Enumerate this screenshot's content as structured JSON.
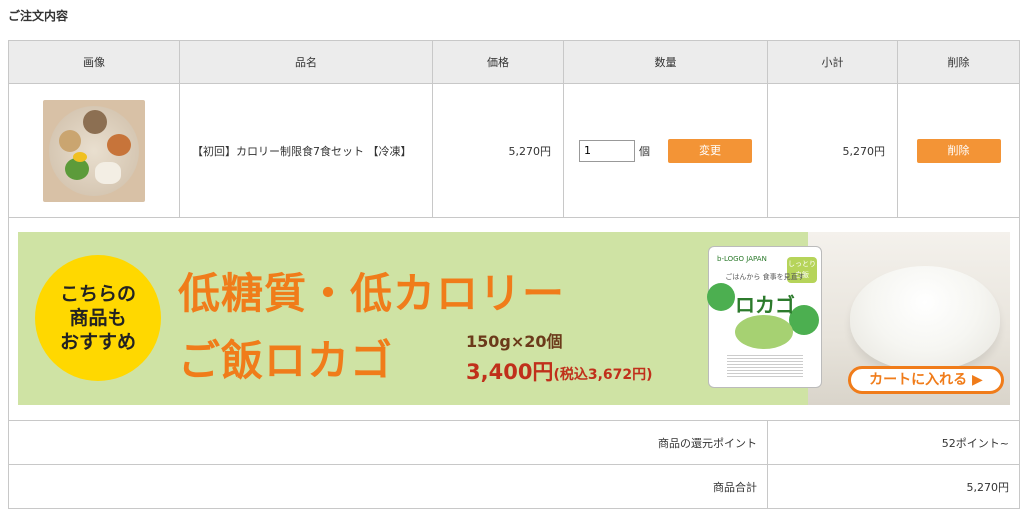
{
  "section_title": "ご注文内容",
  "headers": {
    "image": "画像",
    "name": "品名",
    "price": "価格",
    "quantity": "数量",
    "subtotal": "小計",
    "delete": "削除"
  },
  "item": {
    "name": "【初回】カロリー制限食7食セット 【冷凍】",
    "price": "5,270円",
    "quantity": "1",
    "unit": "個",
    "change_label": "変更",
    "subtotal": "5,270円",
    "delete_label": "削除"
  },
  "banner": {
    "badge_lines": [
      "こちらの",
      "商品も",
      "おすすめ"
    ],
    "headline_1": "低糖質・低カロリー",
    "headline_2": "ご飯ロカゴ",
    "qty_text": "150g×20個",
    "price_text": "3,400円",
    "tax_text": "(税込3,672円)",
    "cart_button": "カートに入れる ▶",
    "pack": {
      "brand": "b-LOGO JAPAN",
      "tagline": "ごはんから 食事を見直す",
      "name": "ロカゴ",
      "tag": "しっとり 白飯"
    }
  },
  "summary": {
    "points_label": "商品の還元ポイント",
    "points_value": "52ポイント~",
    "total_label": "商品合計",
    "total_value": "5,270円"
  },
  "colors": {
    "button_orange": "#f39436",
    "banner_bg": "#cfe3a4",
    "badge_yellow": "#ffd800",
    "headline_orange": "#f07c1a"
  }
}
